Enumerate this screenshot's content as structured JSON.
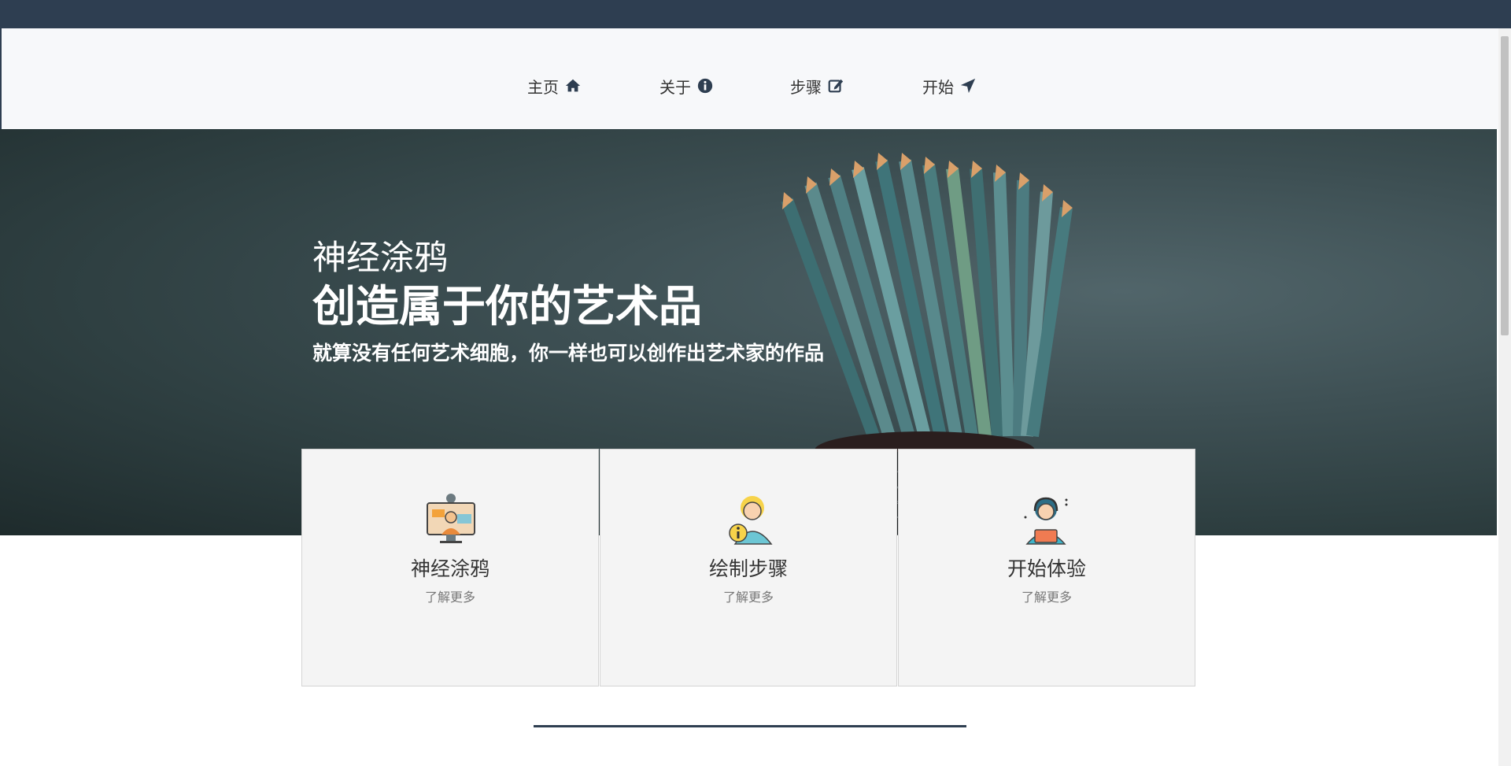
{
  "nav": {
    "items": [
      {
        "label": "主页",
        "icon": "home-icon"
      },
      {
        "label": "关于",
        "icon": "info-circle-icon"
      },
      {
        "label": "步骤",
        "icon": "edit-icon"
      },
      {
        "label": "开始",
        "icon": "location-arrow-icon"
      }
    ]
  },
  "hero": {
    "subtitle": "神经涂鸦",
    "title": "创造属于你的艺术品",
    "tagline": "就算没有任何艺术细胞，你一样也可以创作出艺术家的作品"
  },
  "cards": [
    {
      "title": "神经涂鸦",
      "link": "了解更多",
      "icon": "presenter-screen-icon"
    },
    {
      "title": "绘制步骤",
      "link": "了解更多",
      "icon": "info-person-icon"
    },
    {
      "title": "开始体验",
      "link": "了解更多",
      "icon": "support-agent-icon"
    }
  ],
  "colors": {
    "topbar": "#2e3e51",
    "navbar": "#f7f8fa",
    "card_bg": "#f4f4f4",
    "divider": "#2e3e51"
  }
}
